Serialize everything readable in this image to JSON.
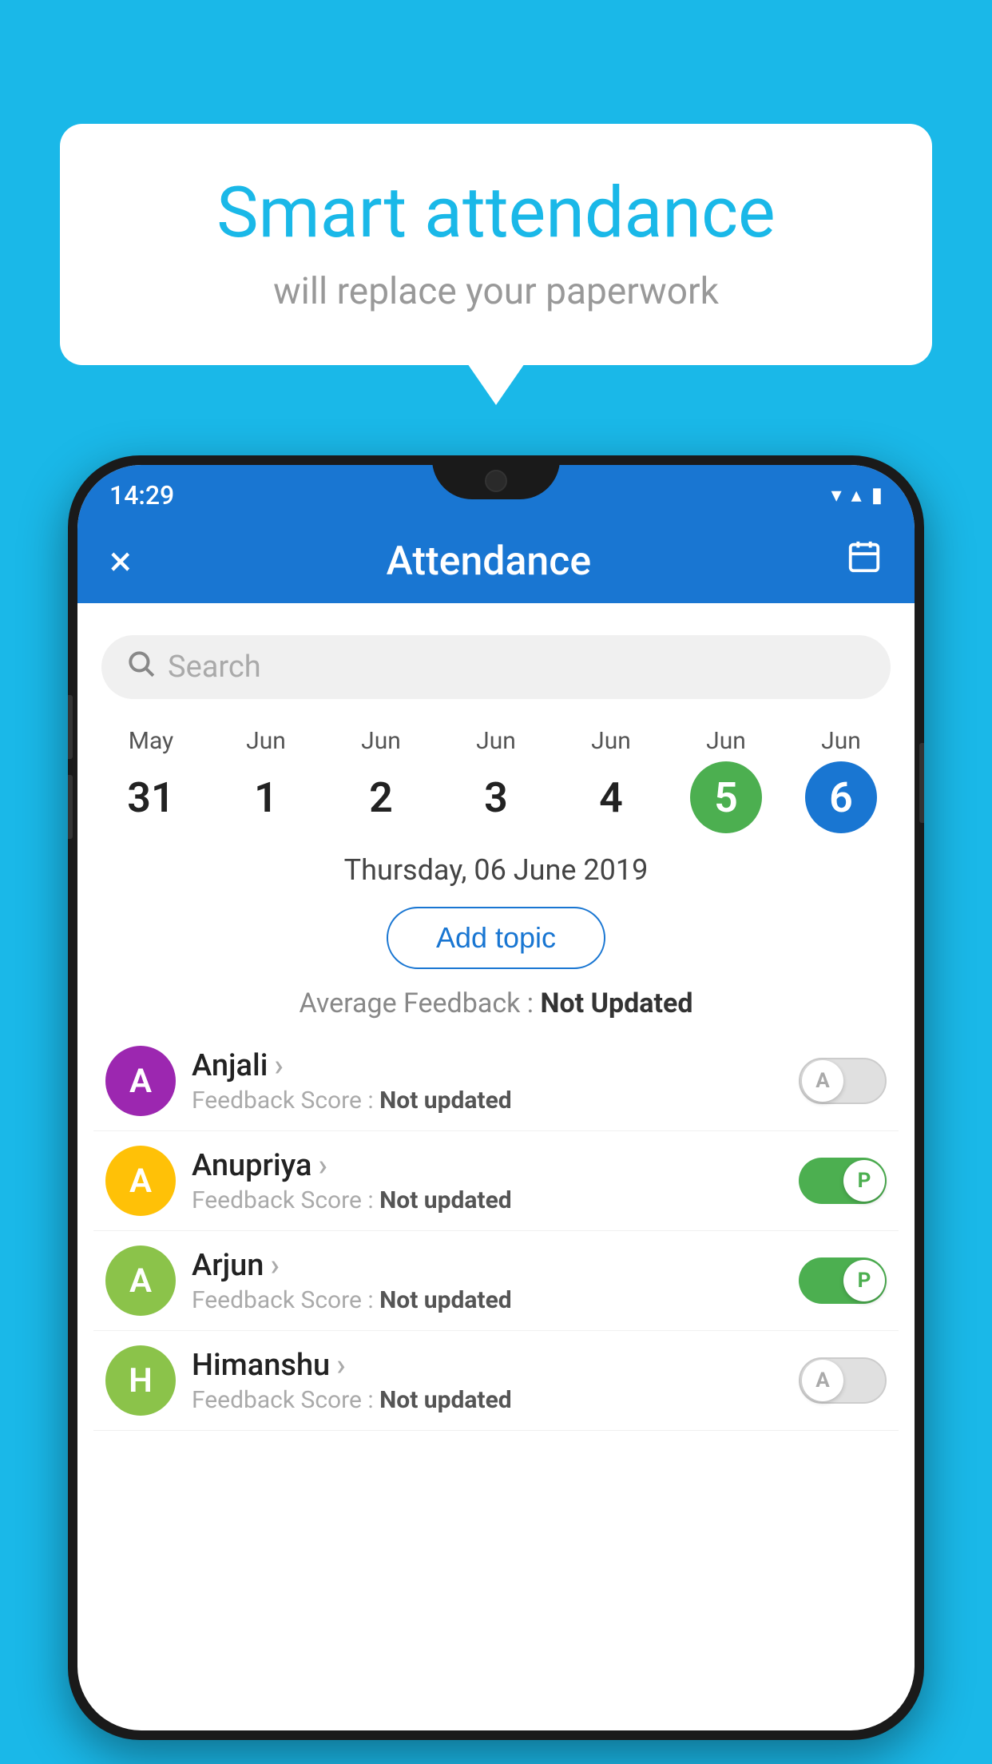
{
  "background_color": "#1ab8e8",
  "speech_bubble": {
    "title": "Smart attendance",
    "subtitle": "will replace your paperwork"
  },
  "status_bar": {
    "time": "14:29",
    "wifi_icon": "▼",
    "signal_icon": "▲",
    "battery_icon": "▮"
  },
  "app_header": {
    "title": "Attendance",
    "close_label": "×",
    "calendar_icon": "📅"
  },
  "search": {
    "placeholder": "Search"
  },
  "dates": [
    {
      "month": "May",
      "day": "31",
      "state": "normal"
    },
    {
      "month": "Jun",
      "day": "1",
      "state": "normal"
    },
    {
      "month": "Jun",
      "day": "2",
      "state": "normal"
    },
    {
      "month": "Jun",
      "day": "3",
      "state": "normal"
    },
    {
      "month": "Jun",
      "day": "4",
      "state": "normal"
    },
    {
      "month": "Jun",
      "day": "5",
      "state": "today"
    },
    {
      "month": "Jun",
      "day": "6",
      "state": "selected"
    }
  ],
  "selected_date_label": "Thursday, 06 June 2019",
  "add_topic_label": "Add topic",
  "avg_feedback_label": "Average Feedback :",
  "avg_feedback_value": "Not Updated",
  "students": [
    {
      "name": "Anjali",
      "avatar_letter": "A",
      "avatar_color": "#9c27b0",
      "feedback_label": "Feedback Score :",
      "feedback_value": "Not updated",
      "toggle_state": "off",
      "toggle_letter": "A"
    },
    {
      "name": "Anupriya",
      "avatar_letter": "A",
      "avatar_color": "#ffc107",
      "feedback_label": "Feedback Score :",
      "feedback_value": "Not updated",
      "toggle_state": "on",
      "toggle_letter": "P"
    },
    {
      "name": "Arjun",
      "avatar_letter": "A",
      "avatar_color": "#8bc34a",
      "feedback_label": "Feedback Score :",
      "feedback_value": "Not updated",
      "toggle_state": "on",
      "toggle_letter": "P"
    },
    {
      "name": "Himanshu",
      "avatar_letter": "H",
      "avatar_color": "#8bc34a",
      "feedback_label": "Feedback Score :",
      "feedback_value": "Not updated",
      "toggle_state": "off",
      "toggle_letter": "A"
    }
  ]
}
